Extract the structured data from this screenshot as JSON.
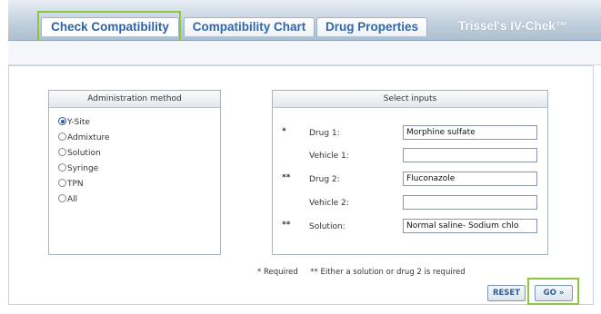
{
  "tabs": [
    {
      "label": "Check Compatibility",
      "active": true
    },
    {
      "label": "Compatibility Chart",
      "active": false
    },
    {
      "label": "Drug Properties",
      "active": false
    }
  ],
  "brand": "Trissel's IV-Chek™",
  "colors": {
    "tab_text": "#2f68b0",
    "highlight": "#8dc63f",
    "header_gradient_top": "#e8eef4",
    "header_gradient_bottom": "#aebfcf"
  },
  "admin_panel": {
    "title": "Administration method",
    "selected": "Y-Site",
    "options": [
      "Y-Site",
      "Admixture",
      "Solution",
      "Syringe",
      "TPN",
      "All"
    ]
  },
  "inputs_panel": {
    "title": "Select inputs",
    "fields": [
      {
        "marker": "*",
        "label": "Drug 1:",
        "value": "Morphine sulfate"
      },
      {
        "marker": "",
        "label": "Vehicle 1:",
        "value": ""
      },
      {
        "marker": "**",
        "label": "Drug 2:",
        "value": "Fluconazole"
      },
      {
        "marker": "",
        "label": "Vehicle 2:",
        "value": ""
      },
      {
        "marker": "**",
        "label": "Solution:",
        "value": "Normal saline- Sodium chlo"
      }
    ]
  },
  "footnote": "* Required     ** Either a solution or drug 2 is required",
  "buttons": {
    "reset": "RESET",
    "go": "GO »"
  }
}
